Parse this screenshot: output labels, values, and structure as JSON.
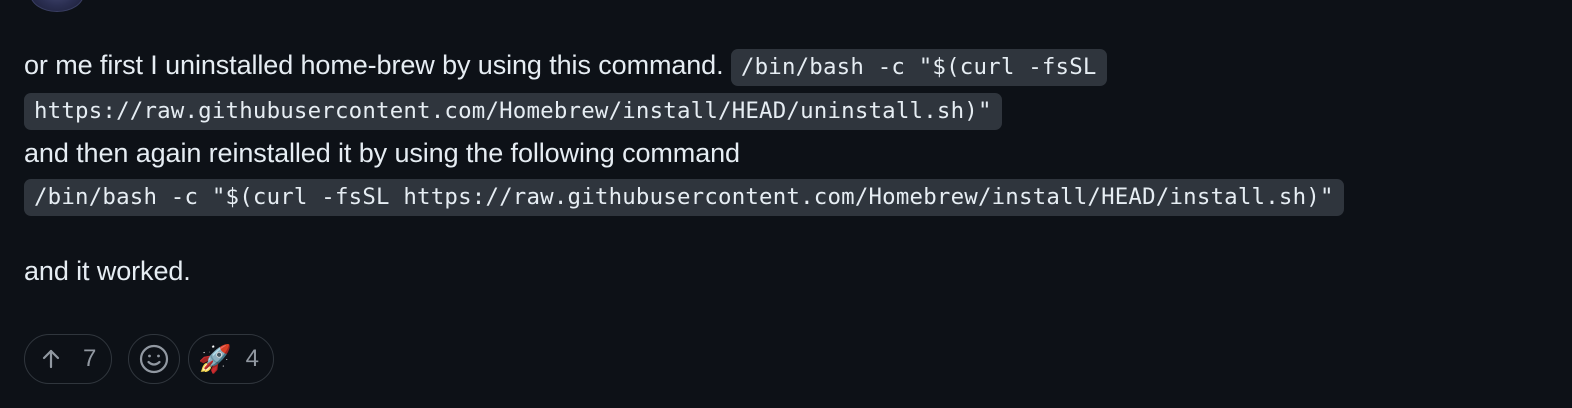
{
  "comment": {
    "intro_text": "or me first I uninstalled home-brew by using this command. ",
    "uninstall_command_part1": "/bin/bash -c \"$(curl -fsSL",
    "uninstall_command_part2": "https://raw.githubusercontent.com/Homebrew/install/HEAD/uninstall.sh)\"",
    "reinstall_text": "and then again reinstalled it by using the following command",
    "install_command": "/bin/bash -c \"$(curl -fsSL https://raw.githubusercontent.com/Homebrew/install/HEAD/install.sh)\"",
    "closing_text": "and it worked."
  },
  "reactions": {
    "upvote": {
      "icon": "arrow-up-icon",
      "count": "7"
    },
    "add_reaction": {
      "icon": "smiley-icon"
    },
    "rocket": {
      "emoji": "🚀",
      "count": "4"
    }
  },
  "colors": {
    "background": "#0d1117",
    "text": "#e6edf3",
    "code_background": "#2f353d",
    "muted": "#9198a1",
    "border": "#30363d"
  }
}
